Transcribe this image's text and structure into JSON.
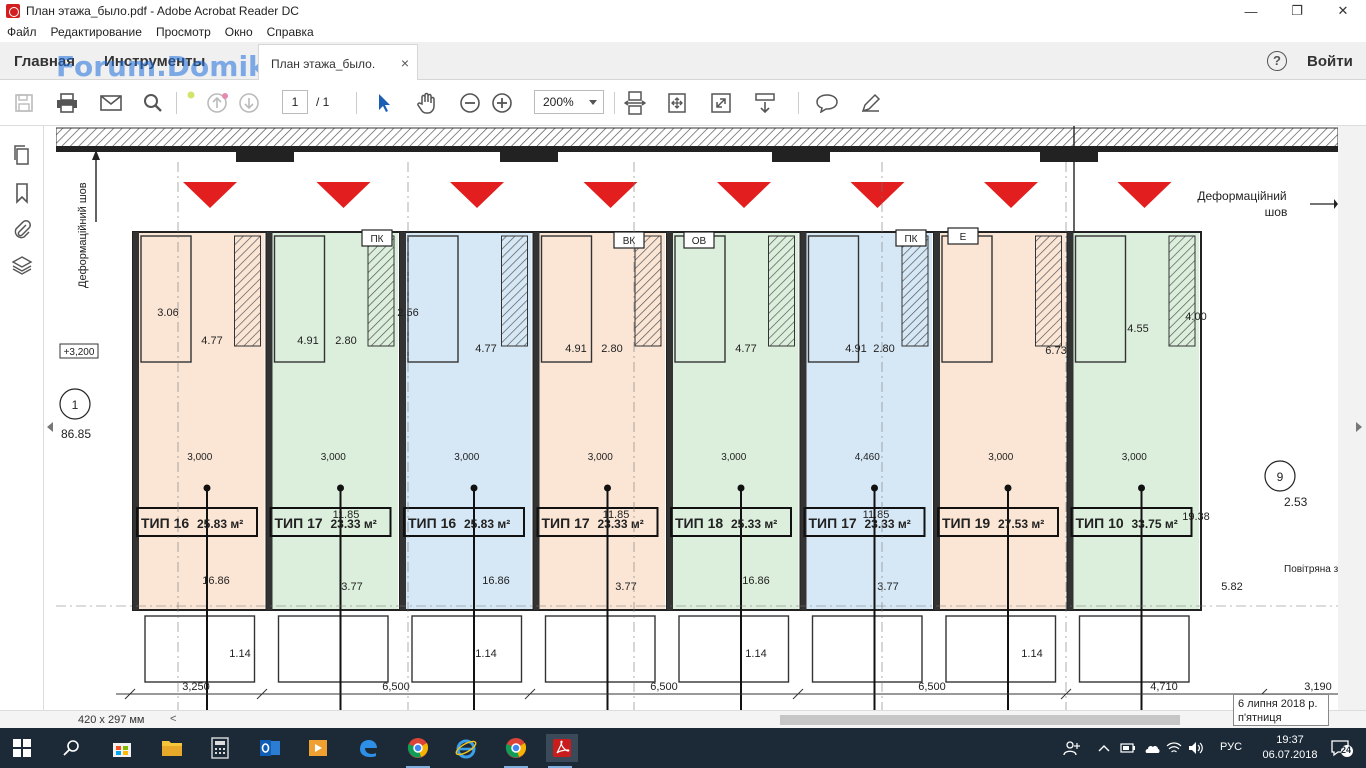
{
  "window": {
    "title": "План этажа_было.pdf - Adobe Acrobat Reader DC",
    "controls": [
      "—",
      "❐",
      "✕"
    ]
  },
  "menu": [
    "Файл",
    "Редактирование",
    "Просмотр",
    "Окно",
    "Справка"
  ],
  "tabs": {
    "home": "Главная",
    "tools": "Инструменты",
    "document": "План этажа_было.",
    "close": "×",
    "help": "?",
    "signin": "Войти",
    "watermark": "Forum.Domik.ua"
  },
  "toolbar": {
    "page_current": "1",
    "page_total": "/ 1",
    "zoom": "200%"
  },
  "plan": {
    "units": [
      {
        "type": "ТИП 16",
        "area": "25.83 м²",
        "fill": "#fbe6d6"
      },
      {
        "type": "ТИП 17",
        "area": "23.33 м²",
        "fill": "#dcefdc"
      },
      {
        "type": "ТИП 16",
        "area": "25.83 м²",
        "fill": "#d6e8f6"
      },
      {
        "type": "ТИП 17",
        "area": "23.33 м²",
        "fill": "#fbe6d6"
      },
      {
        "type": "ТИП 18",
        "area": "25.33 м²",
        "fill": "#dcefdc"
      },
      {
        "type": "ТИП 17",
        "area": "23.33 м²",
        "fill": "#d6e8f6"
      },
      {
        "type": "ТИП 19",
        "area": "27.53 м²",
        "fill": "#fbe6d6"
      },
      {
        "type": "ТИП 10",
        "area": "33.75 м²",
        "fill": "#dcefdc"
      }
    ],
    "labels": {
      "deform_left": "Деформаційний шов",
      "deform_right_1": "Деформаційний",
      "deform_right_2": "шов",
      "axis_1": "1",
      "axis_9": "9",
      "level": "+3,200",
      "mark_left": "86.85",
      "mark_right": "2.53",
      "air_zone": "Повітряна зо",
      "pk": "ПК",
      "vk": "ВК",
      "ov": "ОВ",
      "pk2": "ПК",
      "ep": "Е"
    },
    "areas": [
      "4.77",
      "4.91",
      "2.80",
      "3.06",
      "4.77",
      "4.91",
      "2.80",
      "2.56",
      "4.77",
      "4.91",
      "2.80",
      "6.73",
      "4.55",
      "4.00",
      "11.85",
      "16.86",
      "11.85",
      "16.86",
      "11.85",
      "16.86",
      "19.38",
      "3.77",
      "3.77",
      "3.77",
      "5.82",
      "1.14",
      "1.14",
      "1.14",
      "1.14"
    ],
    "dims_bottom": [
      "3,250",
      "6,500",
      "6,500",
      "6,500",
      "4,710",
      "3,190"
    ],
    "dims_inner": [
      "3,000",
      "3,000",
      "3,000",
      "3,000",
      "3,000",
      "4,460"
    ]
  },
  "statusbar": {
    "page_size": "420 x 297 мм",
    "scroll_left": "<"
  },
  "tooltip": {
    "line1": "6 липня 2018 р.",
    "line2": "п'ятниця"
  },
  "taskbar": {
    "lang": "РУС",
    "time": "19:37",
    "date": "06.07.2018",
    "notifications": "24"
  }
}
